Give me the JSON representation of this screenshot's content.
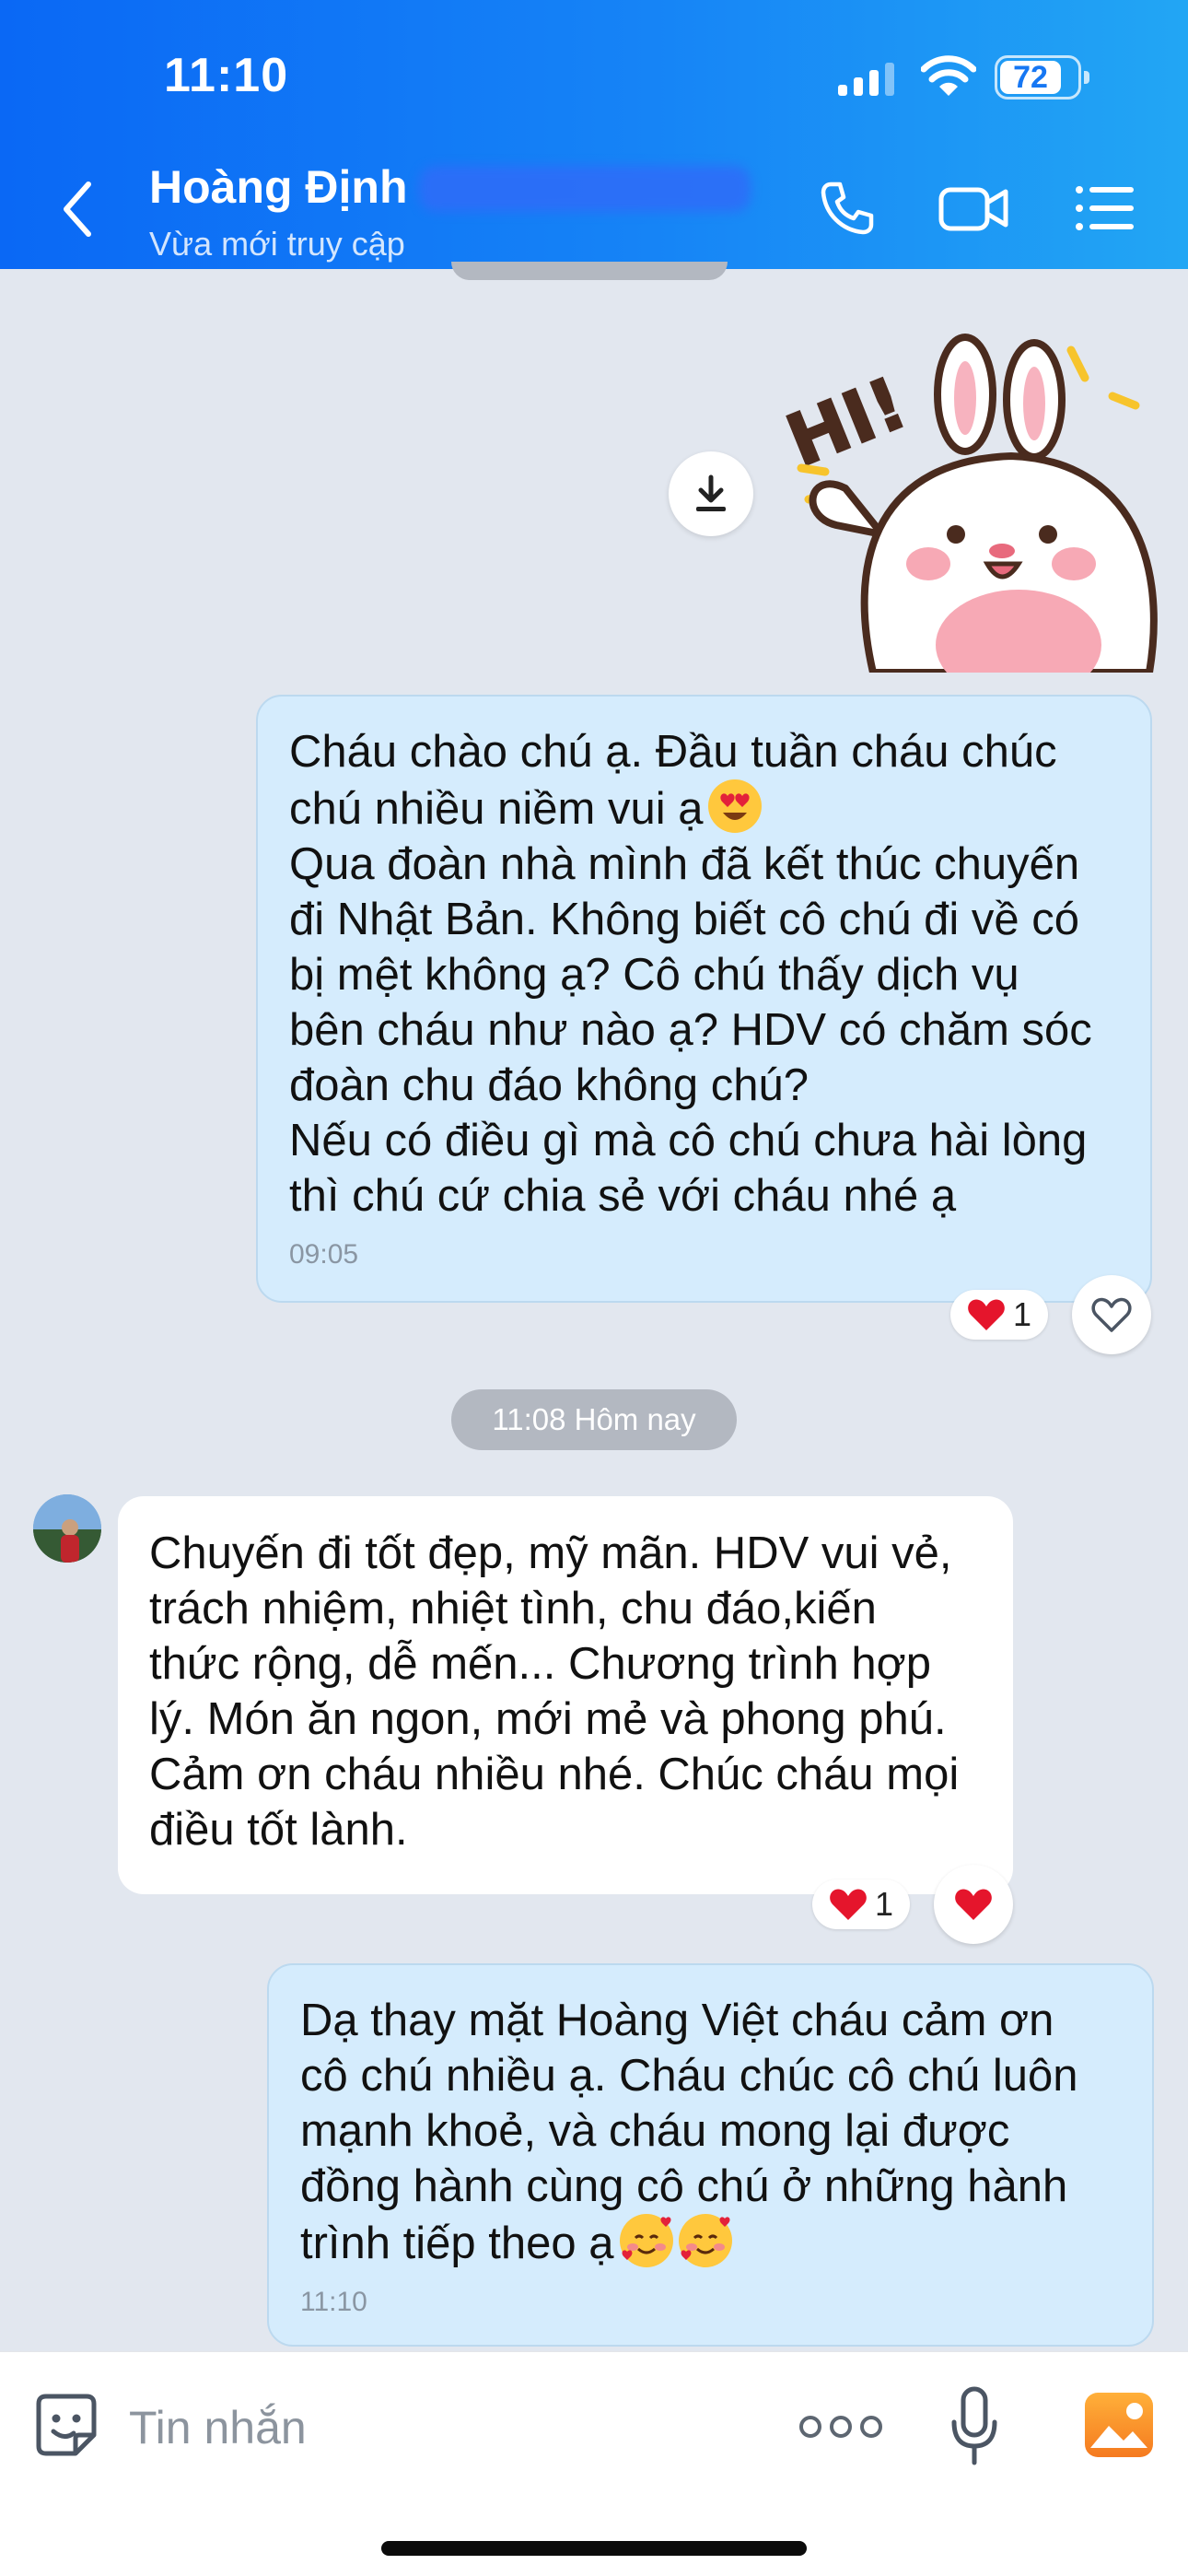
{
  "status_bar": {
    "time": "11:10",
    "battery": "72"
  },
  "header": {
    "contact_name": "Hoàng Định",
    "contact_status": "Vừa mới truy cập"
  },
  "messages": [
    {
      "direction": "outgoing",
      "lines": [
        "Cháu chào chú ạ. Đầu tuần cháu chúc",
        "chú nhiều niềm vui ạ",
        "Qua đoàn nhà mình đã kết thúc chuyến",
        "đi Nhật Bản. Không biết cô chú đi về có",
        "bị mệt không ạ? Cô chú thấy dịch vụ",
        "bên cháu như nào ạ? HDV có chăm sóc",
        "đoàn chu đáo không chú?",
        "Nếu có điều gì mà cô chú chưa hài lòng",
        "thì chú cứ chia sẻ với cháu nhé ạ"
      ],
      "time": "09:05",
      "reaction_count": "1"
    },
    {
      "direction": "incoming",
      "lines": [
        "Chuyến đi tốt đẹp, mỹ mãn. HDV vui vẻ,",
        "trách nhiệm, nhiệt tình, chu đáo,kiến",
        "thức rộng, dễ mến... Chương trình hợp",
        "lý. Món ăn ngon, mới mẻ và phong phú.",
        "Cảm ơn cháu nhiều nhé. Chúc cháu mọi",
        "điều tốt lành."
      ],
      "reaction_count": "1"
    },
    {
      "direction": "outgoing",
      "lines": [
        "Dạ thay mặt Hoàng Việt cháu cảm ơn",
        "cô chú nhiều ạ. Cháu chúc cô chú luôn",
        "mạnh khoẻ, và cháu mong lại được",
        "đồng hành cùng cô chú ở những hành",
        "trình tiếp theo ạ"
      ],
      "time": "11:10"
    }
  ],
  "date_separator": "11:08 Hôm nay",
  "sticker_text": "HI!",
  "input": {
    "placeholder": "Tin nhắn"
  },
  "colors": {
    "header_gradient_start": "#0a68f5",
    "header_gradient_end": "#22a6f4",
    "chat_background": "#e2e7ef",
    "outgoing_bubble": "#d5ecfd",
    "incoming_bubble": "#ffffff",
    "reaction_heart": "#e5152c"
  },
  "icons": [
    "back-chevron-icon",
    "phone-icon",
    "video-camera-icon",
    "list-menu-icon",
    "download-icon",
    "heart-icon",
    "heart-outline-icon",
    "smile-sticker-icon",
    "more-dots-icon",
    "microphone-icon",
    "image-icon"
  ]
}
